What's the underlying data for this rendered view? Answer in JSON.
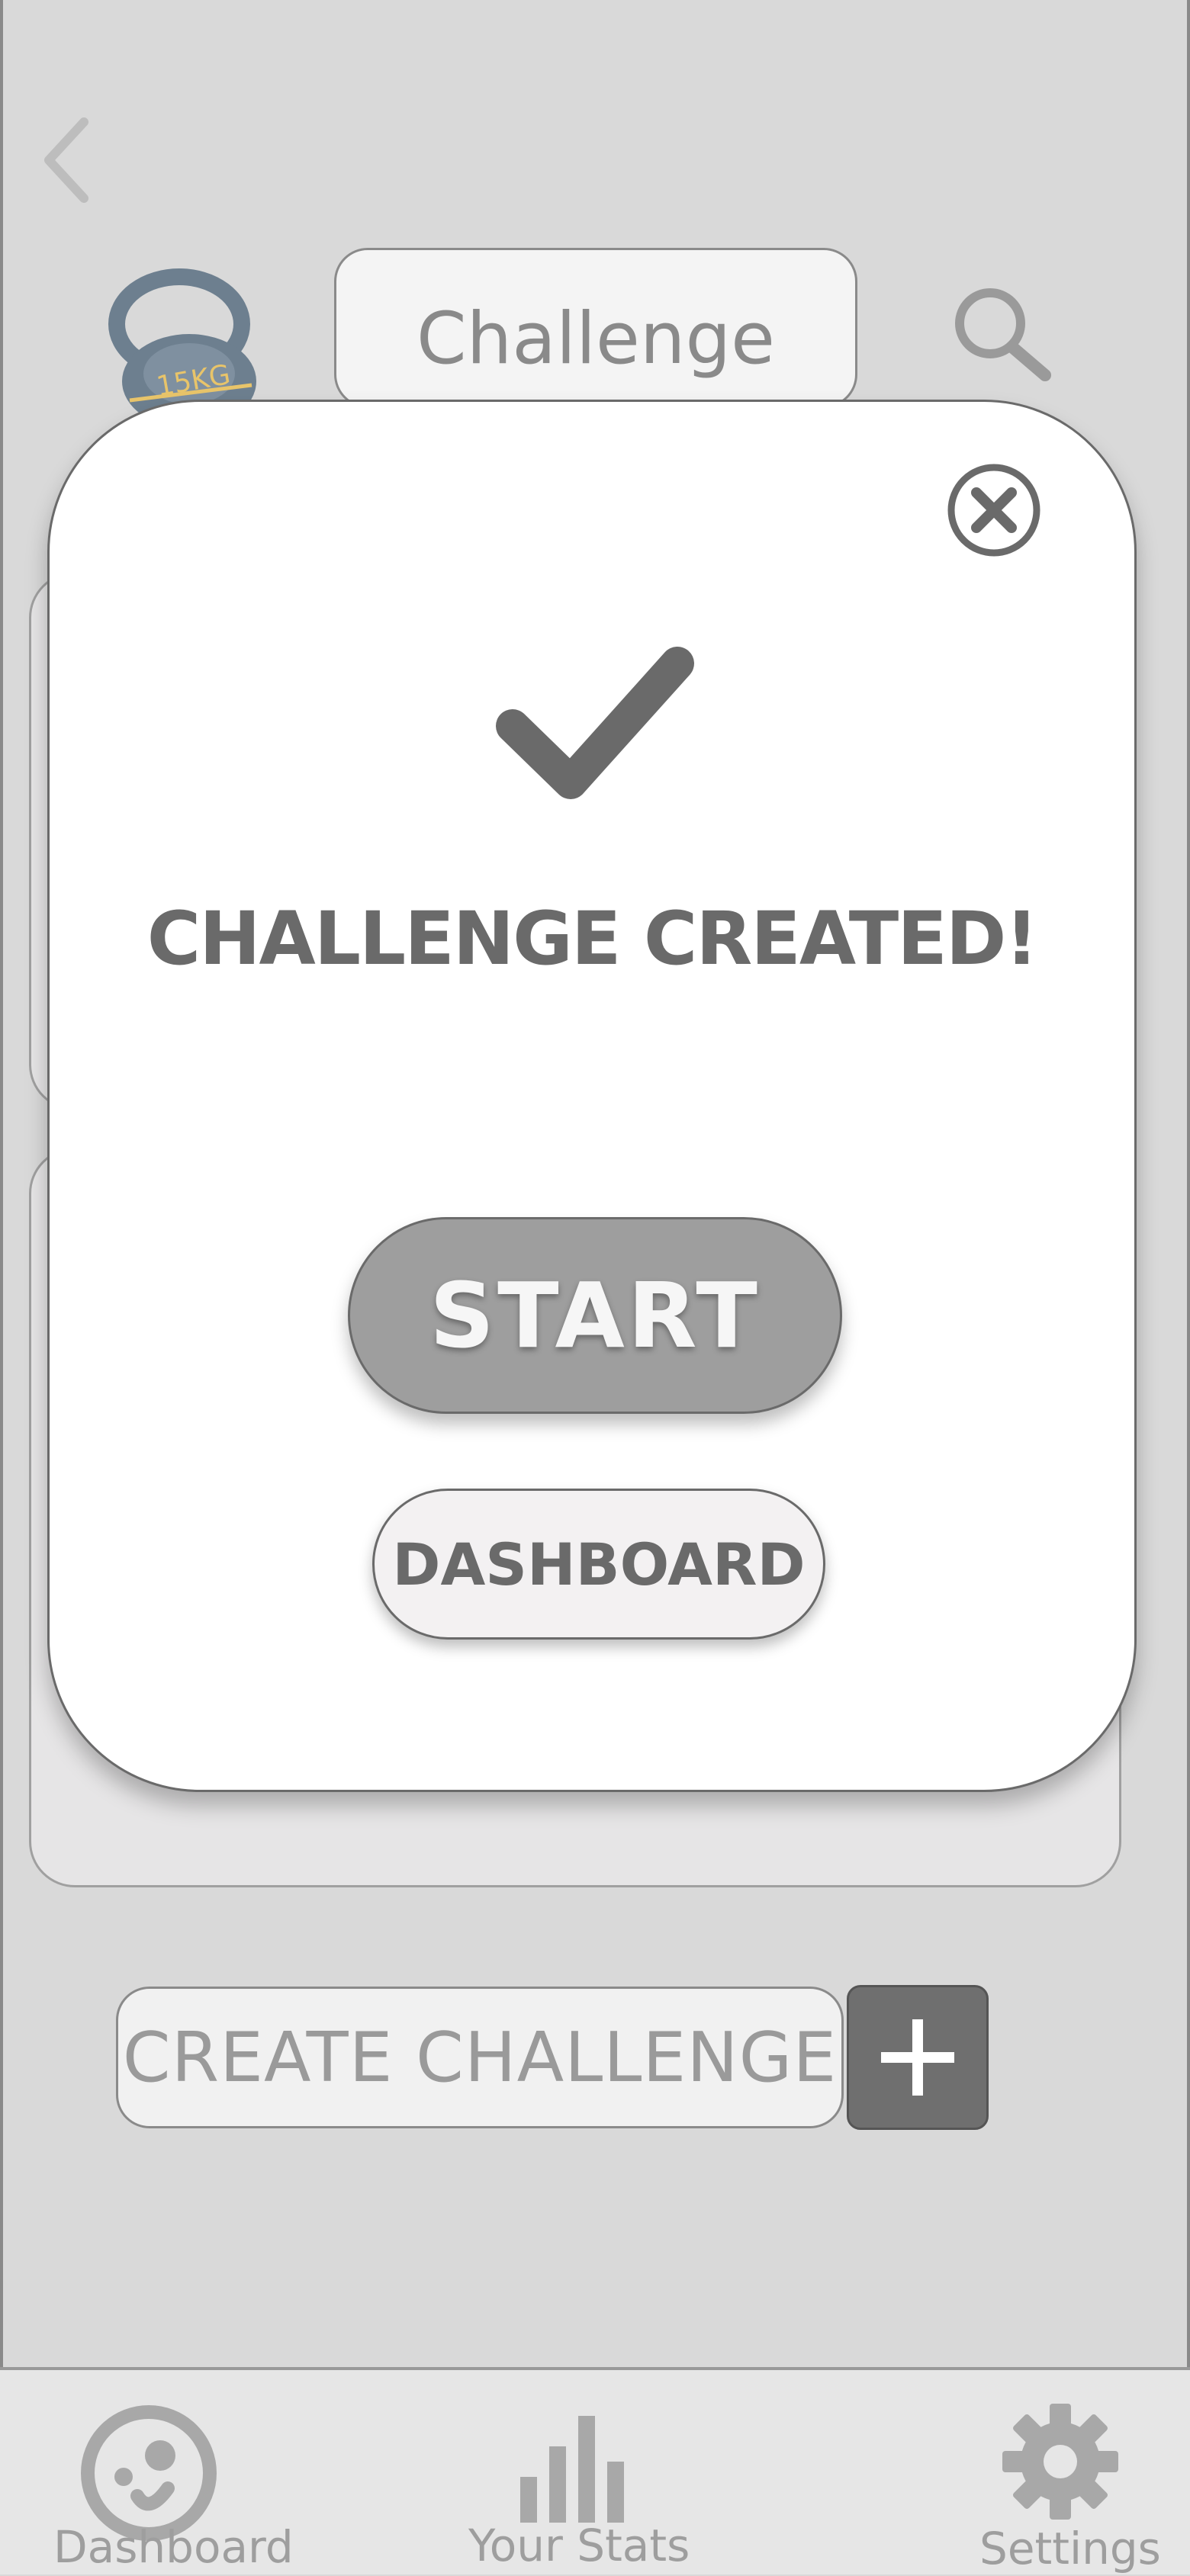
{
  "header": {
    "title": "Challenge",
    "back_icon": "chevron-left-icon",
    "search_icon": "search-icon",
    "logo": {
      "icon": "kettlebell-icon",
      "weight_text": "15KG"
    }
  },
  "main": {
    "create_challenge_label": "CREATE CHALLENGE",
    "add_icon": "plus-icon"
  },
  "bottom_nav": {
    "items": [
      {
        "label": "Dashboard",
        "icon": "dashboard-icon"
      },
      {
        "label": "Your Stats",
        "icon": "bar-chart-icon"
      },
      {
        "label": "Settings",
        "icon": "gear-icon"
      }
    ]
  },
  "modal": {
    "close_icon": "close-circle-icon",
    "check_icon": "checkmark-icon",
    "title": "CHALLENGE CREATED!",
    "start_label": "START",
    "dashboard_label": "DASHBOARD"
  },
  "colors": {
    "background": "#d9d9d9",
    "modal_bg": "#ffffff",
    "primary_button": "#9e9e9e",
    "dark_accent": "#6f6f6f",
    "kettlebell": "#6d7f8f",
    "kettlebell_text": "#e8c46a"
  }
}
